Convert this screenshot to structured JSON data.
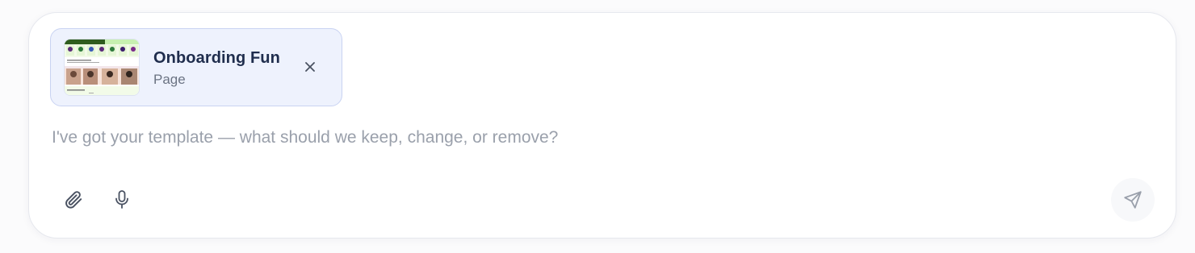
{
  "attachment": {
    "title": "Onboarding Fun",
    "type": "Page",
    "thumbnail_icon": "page-preview-thumbnail",
    "close_icon": "close-icon"
  },
  "composer": {
    "placeholder": "I've got your template — what should we keep, change, or remove?",
    "value": ""
  },
  "toolbar": {
    "attach_icon": "paperclip-icon",
    "mic_icon": "microphone-icon",
    "send_icon": "send-icon"
  },
  "colors": {
    "attachment_bg": "#eef2fd",
    "attachment_border": "#c9d3f2",
    "title": "#1f2d4d",
    "subtitle": "#6b7383",
    "placeholder": "#9aa0ab",
    "icon": "#4a5262",
    "send_icon": "#9aa0ab"
  }
}
